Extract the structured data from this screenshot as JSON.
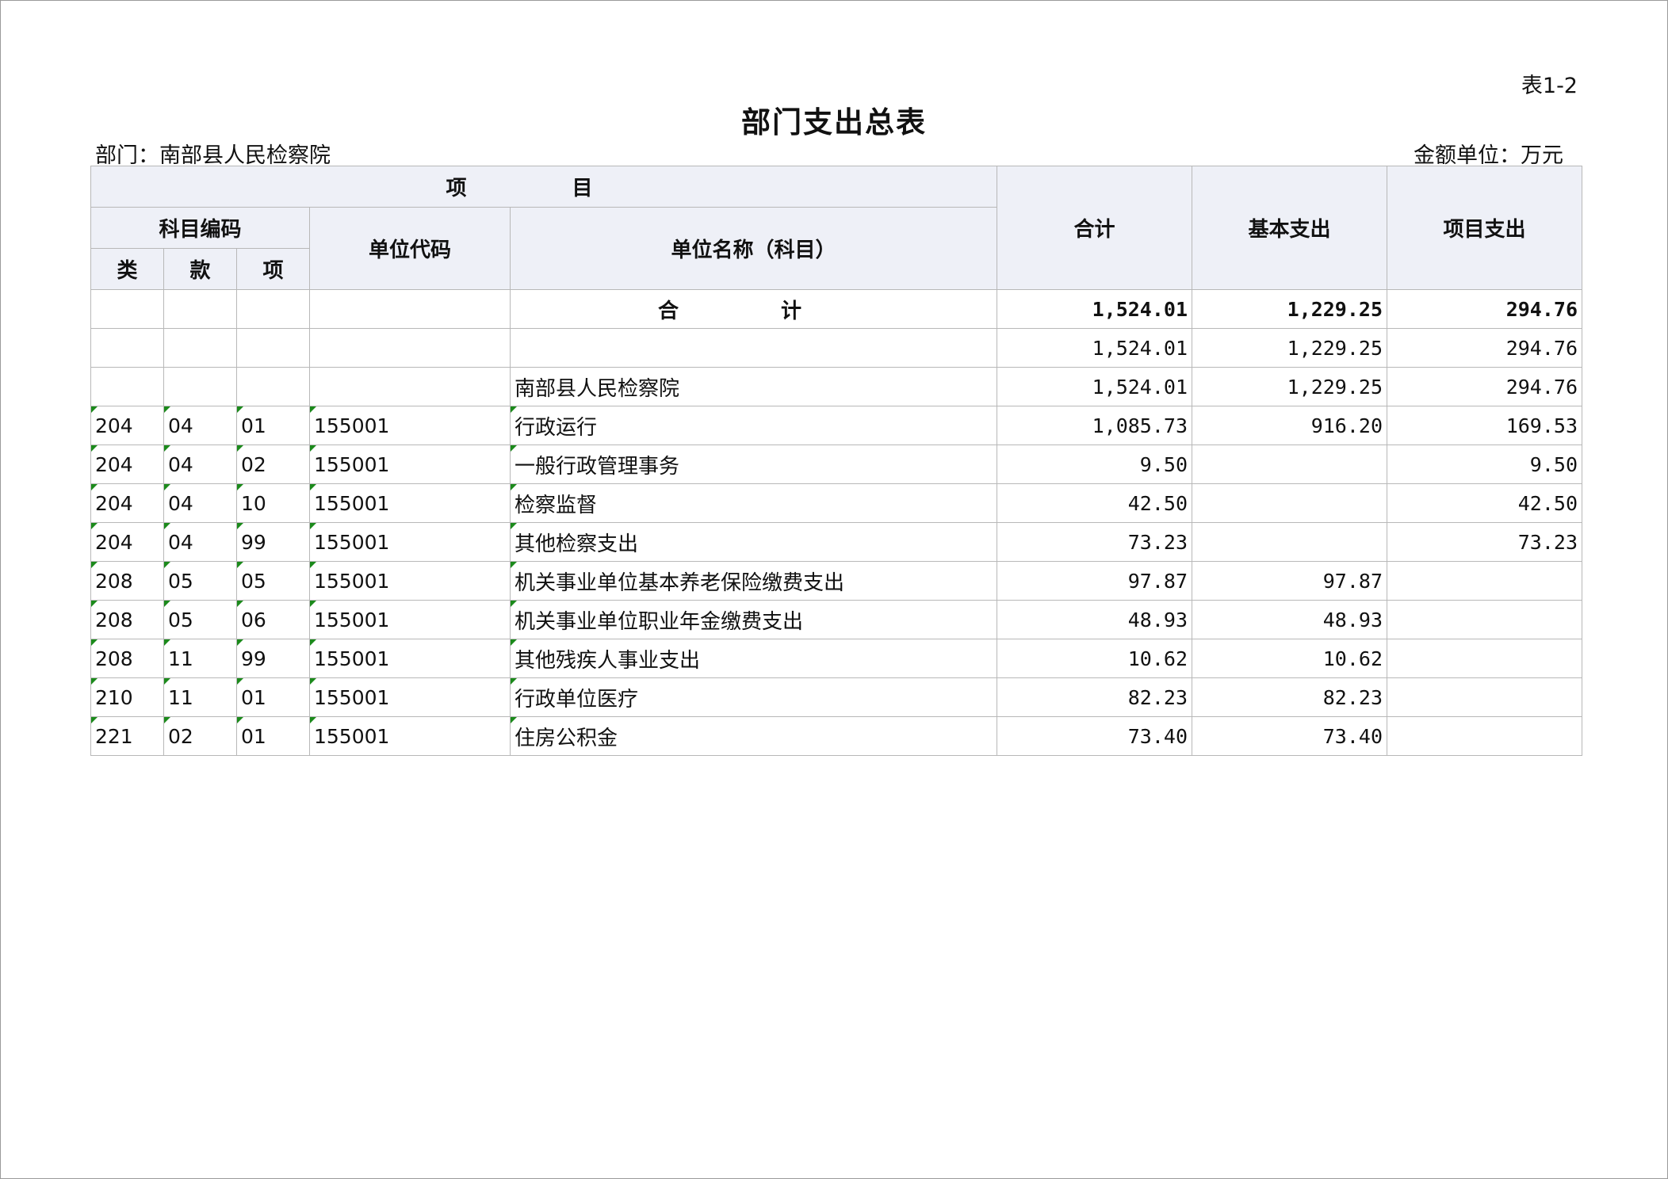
{
  "table_no": "表1-2",
  "title": "部门支出总表",
  "department": "部门：南部县人民检察院",
  "unit": "金额单位：万元",
  "headers": {
    "project": "项 目",
    "subject_code": "科目编码",
    "class": "类",
    "section": "款",
    "item": "项",
    "unit_code": "单位代码",
    "unit_name": "单位名称（科目）",
    "total": "合计",
    "basic": "基本支出",
    "project_exp": "项目支出"
  },
  "sum_row": {
    "label": "合 计",
    "total": "1,524.01",
    "basic": "1,229.25",
    "project": "294.76"
  },
  "blank_row": {
    "total": "1,524.01",
    "basic": "1,229.25",
    "project": "294.76"
  },
  "org_row": {
    "name": "南部县人民检察院",
    "total": "1,524.01",
    "basic": "1,229.25",
    "project": "294.76"
  },
  "rows": [
    {
      "cls": "204",
      "sec": "04",
      "item": "01",
      "code": "155001",
      "name": "行政运行",
      "total": "1,085.73",
      "basic": "916.20",
      "project": "169.53"
    },
    {
      "cls": "204",
      "sec": "04",
      "item": "02",
      "code": "155001",
      "name": "一般行政管理事务",
      "total": "9.50",
      "basic": "",
      "project": "9.50"
    },
    {
      "cls": "204",
      "sec": "04",
      "item": "10",
      "code": "155001",
      "name": "检察监督",
      "total": "42.50",
      "basic": "",
      "project": "42.50"
    },
    {
      "cls": "204",
      "sec": "04",
      "item": "99",
      "code": "155001",
      "name": "其他检察支出",
      "total": "73.23",
      "basic": "",
      "project": "73.23"
    },
    {
      "cls": "208",
      "sec": "05",
      "item": "05",
      "code": "155001",
      "name": "机关事业单位基本养老保险缴费支出",
      "total": "97.87",
      "basic": "97.87",
      "project": ""
    },
    {
      "cls": "208",
      "sec": "05",
      "item": "06",
      "code": "155001",
      "name": "机关事业单位职业年金缴费支出",
      "total": "48.93",
      "basic": "48.93",
      "project": ""
    },
    {
      "cls": "208",
      "sec": "11",
      "item": "99",
      "code": "155001",
      "name": "其他残疾人事业支出",
      "total": "10.62",
      "basic": "10.62",
      "project": ""
    },
    {
      "cls": "210",
      "sec": "11",
      "item": "01",
      "code": "155001",
      "name": "行政单位医疗",
      "total": "82.23",
      "basic": "82.23",
      "project": ""
    },
    {
      "cls": "221",
      "sec": "02",
      "item": "01",
      "code": "155001",
      "name": "住房公积金",
      "total": "73.40",
      "basic": "73.40",
      "project": ""
    }
  ]
}
